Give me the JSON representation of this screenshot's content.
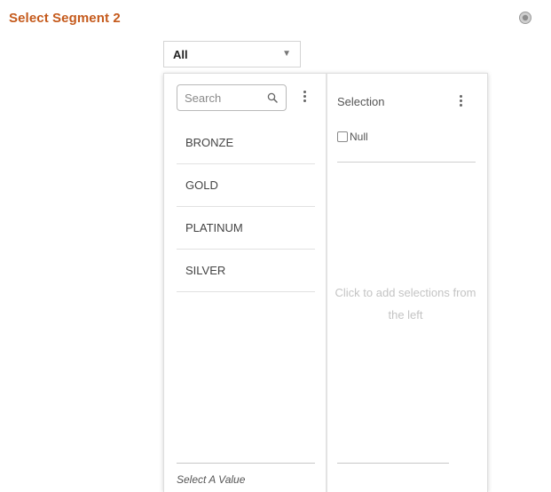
{
  "header": {
    "title": "Select Segment 2",
    "title_color": "#c55a1c",
    "settings_icon": "gear-icon"
  },
  "dropdown": {
    "value": "All",
    "caret_icon": "chevron-down-icon",
    "caret_glyph": "▼"
  },
  "available": {
    "search_placeholder": "Search",
    "search_icon": "search-icon",
    "menu_icon": "kebab-menu-icon",
    "items": [
      {
        "label": "BRONZE"
      },
      {
        "label": "GOLD"
      },
      {
        "label": "PLATINUM"
      },
      {
        "label": "SILVER"
      }
    ],
    "footer": "Select A Value"
  },
  "selection": {
    "header": "Selection",
    "menu_icon": "kebab-menu-icon",
    "null_label": "Null",
    "null_checked": false,
    "empty_message": "Click to add selections from the left"
  }
}
